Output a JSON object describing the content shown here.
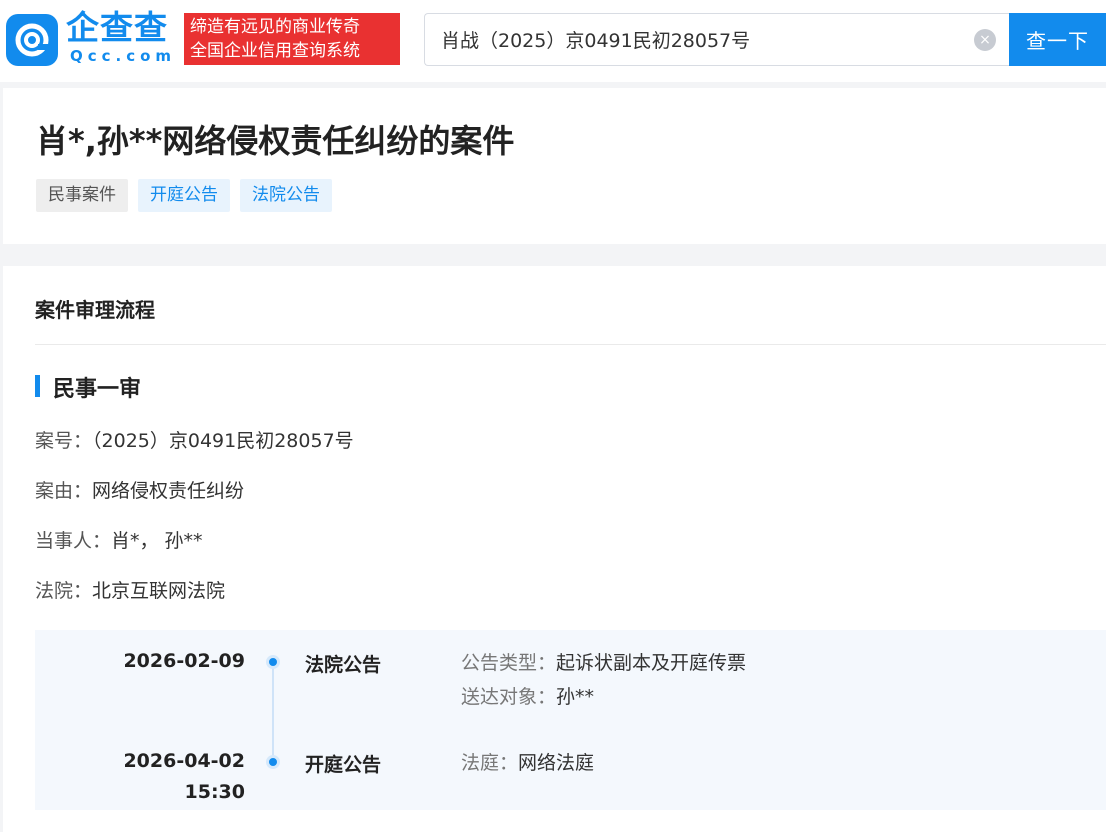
{
  "header": {
    "logo_text": "企查查",
    "logo_domain": "Qcc.com",
    "slogan_line1": "缔造有远见的商业传奇",
    "slogan_line2": "全国企业信用查询系统",
    "search_value": "肖战（2025）京0491民初28057号",
    "search_button": "查一下",
    "clear_glyph": "×"
  },
  "case": {
    "title": "肖*,孙**网络侵权责任纠纷的案件",
    "tags": [
      "民事案件",
      "开庭公告",
      "法院公告"
    ]
  },
  "process": {
    "section_title": "案件审理流程",
    "stage_title": "民事一审",
    "case_no_label": "案号：",
    "case_no": "（2025）京0491民初28057号",
    "cause_label": "案由：",
    "cause": "网络侵权责任纠纷",
    "parties_label": "当事人：",
    "parties": "肖*， 孙**",
    "court_label": "法院：",
    "court": "北京互联网法院",
    "timeline": [
      {
        "date": "2026-02-09",
        "time": "",
        "type": "法院公告",
        "detail1_label": "公告类型：",
        "detail1_value": "起诉状副本及开庭传票",
        "detail2_label": "送达对象：",
        "detail2_value": "孙**"
      },
      {
        "date": "2026-04-02",
        "time": "15:30",
        "type": "开庭公告",
        "detail1_label": "法庭：",
        "detail1_value": "网络法庭"
      }
    ]
  },
  "colors": {
    "brand_blue": "#128bed",
    "slogan_red": "#e93131"
  }
}
